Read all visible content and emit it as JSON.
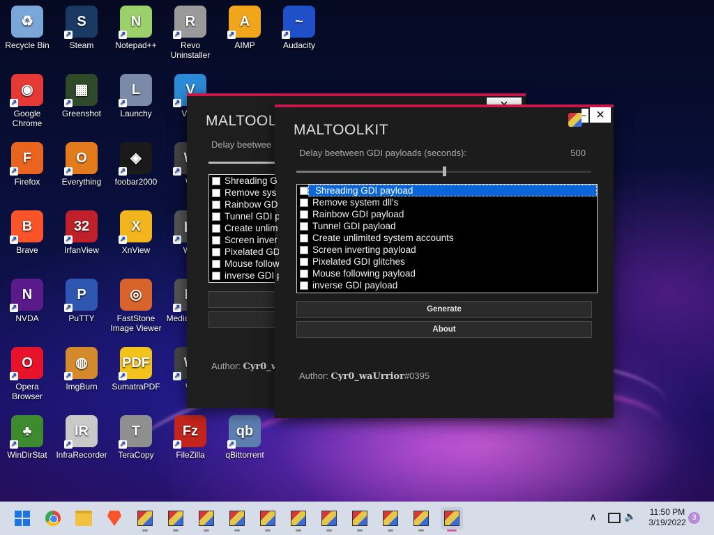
{
  "desktop": {
    "icons": [
      {
        "label": "Recycle Bin",
        "glyph": "♻",
        "color": "#7aa7d8",
        "shortcut": false
      },
      {
        "label": "Steam",
        "glyph": "S",
        "color": "#1b3a63",
        "shortcut": true
      },
      {
        "label": "Notepad++",
        "glyph": "N",
        "color": "#9bd06a",
        "shortcut": true
      },
      {
        "label": "Revo Uninstaller",
        "glyph": "R",
        "color": "#9a9a9a",
        "shortcut": true
      },
      {
        "label": "AIMP",
        "glyph": "A",
        "color": "#f0a51b",
        "shortcut": true
      },
      {
        "label": "Audacity",
        "glyph": "~",
        "color": "#1f4fc9",
        "shortcut": true
      },
      {
        "label": "Google Chrome",
        "glyph": "◉",
        "color": "#e53935",
        "shortcut": true
      },
      {
        "label": "Greenshot",
        "glyph": "▦",
        "color": "#2f4a2a",
        "shortcut": true
      },
      {
        "label": "Launchy",
        "glyph": "L",
        "color": "#7a8aa8",
        "shortcut": true
      },
      {
        "label": "VNC",
        "glyph": "V",
        "color": "#2c8bd6",
        "shortcut": true
      },
      {
        "label": "Firefox",
        "glyph": "F",
        "color": "#e8641f",
        "shortcut": true
      },
      {
        "label": "Everything",
        "glyph": "O",
        "color": "#e37b1c",
        "shortcut": true
      },
      {
        "label": "foobar2000",
        "glyph": "◈",
        "color": "#1a1a1a",
        "shortcut": true
      },
      {
        "label": "Wi",
        "glyph": "W",
        "color": "#444",
        "shortcut": true
      },
      {
        "label": "Brave",
        "glyph": "B",
        "color": "#fb542b",
        "shortcut": true
      },
      {
        "label": "IrfanView",
        "glyph": "32",
        "color": "#c0202a",
        "shortcut": true
      },
      {
        "label": "XnView",
        "glyph": "X",
        "color": "#f2b51d",
        "shortcut": true
      },
      {
        "label": "Win",
        "glyph": "▶",
        "color": "#555",
        "shortcut": true
      },
      {
        "label": "NVDA",
        "glyph": "N",
        "color": "#5b1a8a",
        "shortcut": true
      },
      {
        "label": "PuTTY",
        "glyph": "P",
        "color": "#2f56b0",
        "shortcut": true
      },
      {
        "label": "FastStone Image Viewer",
        "glyph": "◎",
        "color": "#d9642b",
        "shortcut": false
      },
      {
        "label": "Media Classi",
        "glyph": "M",
        "color": "#555",
        "shortcut": true
      },
      {
        "label": "Opera Browser",
        "glyph": "O",
        "color": "#e6132b",
        "shortcut": true
      },
      {
        "label": "ImgBurn",
        "glyph": "◍",
        "color": "#d48a2a",
        "shortcut": true
      },
      {
        "label": "SumatraPDF",
        "glyph": "PDF",
        "color": "#f2c31b",
        "shortcut": true
      },
      {
        "label": "Wi",
        "glyph": "W",
        "color": "#444",
        "shortcut": true
      },
      {
        "label": "WinDirStat",
        "glyph": "♣",
        "color": "#3d8a2f",
        "shortcut": true
      },
      {
        "label": "InfraRecorder",
        "glyph": "IR",
        "color": "#c9c9c9",
        "shortcut": true
      },
      {
        "label": "TeraCopy",
        "glyph": "T",
        "color": "#8f8f8f",
        "shortcut": true
      },
      {
        "label": "FileZilla",
        "glyph": "Fz",
        "color": "#c4241c",
        "shortcut": true
      },
      {
        "label": "qBittorrent",
        "glyph": "qb",
        "color": "#5c7fb0",
        "shortcut": true
      }
    ]
  },
  "back_window": {
    "title": "MALTOOL",
    "delay_label": "Delay beetwee",
    "items": [
      "Shreading G",
      "Remove sys",
      "Rainbow GD",
      "Tunnel GDI p",
      "Create unlim",
      "Screen inver",
      "Pixelated GD",
      "Mouse follow",
      "inverse GDI p"
    ],
    "author_prefix": "Author: ",
    "author_name": "Cyr0_w",
    "close_glyph": "✕"
  },
  "main_window": {
    "title": "MALTOOLKIT",
    "delay_label": "Delay beetween GDI payloads (seconds):",
    "delay_value": "500",
    "slider_fraction": 0.5,
    "items": [
      {
        "label": "Shreading GDI payload",
        "checked": false,
        "selected": true
      },
      {
        "label": "Remove system dll's",
        "checked": false,
        "selected": false
      },
      {
        "label": "Rainbow GDI payload",
        "checked": false,
        "selected": false
      },
      {
        "label": "Tunnel GDI payload",
        "checked": false,
        "selected": false
      },
      {
        "label": "Create unlimited system accounts",
        "checked": false,
        "selected": false
      },
      {
        "label": "Screen inverting payload",
        "checked": false,
        "selected": false
      },
      {
        "label": "Pixelated GDI glitches",
        "checked": false,
        "selected": false
      },
      {
        "label": "Mouse following payload",
        "checked": false,
        "selected": false
      },
      {
        "label": "inverse GDI payload",
        "checked": false,
        "selected": false
      }
    ],
    "generate_label": "Generate",
    "about_label": "About",
    "author_prefix": "Author: ",
    "author_name": "Cyr0_waUrrior",
    "author_tag": "#0395",
    "close_glyph": "✕",
    "minimize_glyph": "–"
  },
  "taskbar": {
    "time": "11:50 PM",
    "date": "3/19/2022",
    "notification_count": "3",
    "tray_chevron": "∧",
    "app_count": 11
  },
  "colors": {
    "accent_red": "#c8174a",
    "selection_blue": "#0a66d8"
  }
}
